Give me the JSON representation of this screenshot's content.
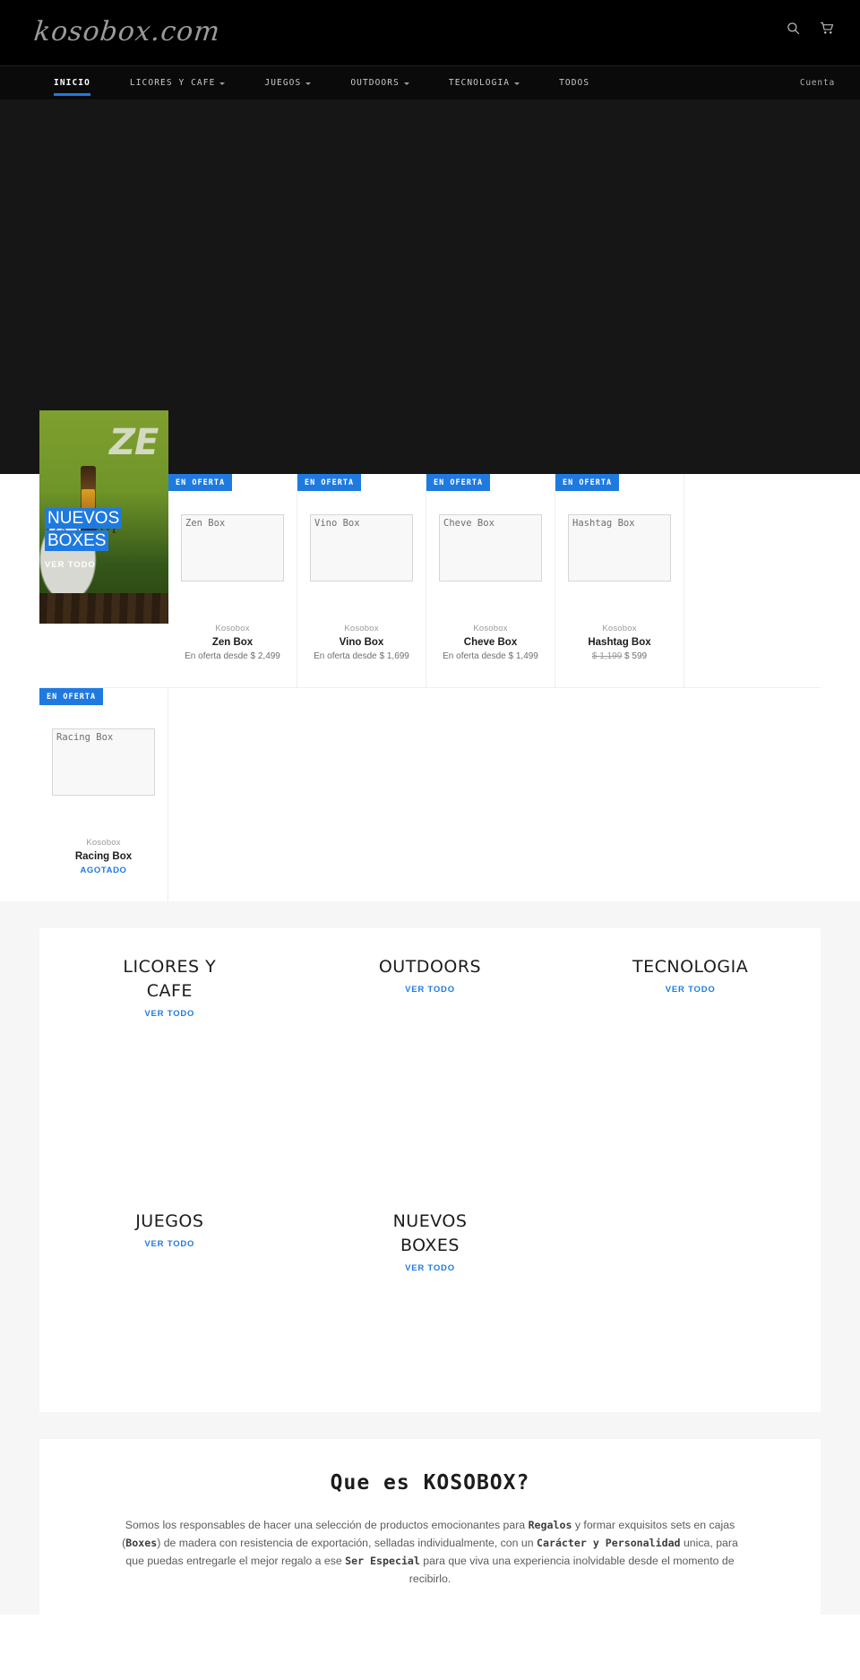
{
  "header": {
    "logo_text": "kosobox.com",
    "search_icon": "search-icon",
    "cart_icon": "cart-icon"
  },
  "nav": {
    "items": [
      {
        "label": "INICIO",
        "has_caret": false,
        "active": true
      },
      {
        "label": "LICORES Y CAFE",
        "has_caret": true,
        "active": false
      },
      {
        "label": "JUEGOS",
        "has_caret": true,
        "active": false
      },
      {
        "label": "OUTDOORS",
        "has_caret": true,
        "active": false
      },
      {
        "label": "TECNOLOGIA",
        "has_caret": true,
        "active": false
      },
      {
        "label": "TODOS",
        "has_caret": false,
        "active": false
      }
    ],
    "account_label": "Cuenta"
  },
  "promo": {
    "title_line1": "NUEVOS",
    "title_line2": "BOXES",
    "link_label": "VER TODO",
    "image_text_zen": "ZE",
    "image_text_b": "B",
    "image_script": "ox.com",
    "highlight_color": "#1f7ae0"
  },
  "products": {
    "sale_badge_label": "EN OFERTA",
    "sold_out_label": "AGOTADO",
    "items": [
      {
        "alt_text": "Zen Box",
        "vendor": "Kosobox",
        "title": "Zen Box",
        "price": "En oferta desde $ 2,499",
        "on_sale": true,
        "sold_out": false
      },
      {
        "alt_text": "Vino Box",
        "vendor": "Kosobox",
        "title": "Vino Box",
        "price": "En oferta desde $ 1,699",
        "on_sale": true,
        "sold_out": false
      },
      {
        "alt_text": "Cheve Box",
        "vendor": "Kosobox",
        "title": "Cheve Box",
        "price": "En oferta desde $ 1,499",
        "on_sale": true,
        "sold_out": false
      },
      {
        "alt_text": "Hashtag Box",
        "vendor": "Kosobox",
        "title": "Hashtag Box",
        "price_was": "$ 1,199",
        "price_now": "$ 599",
        "on_sale": true,
        "sold_out": false
      },
      {
        "alt_text": "Racing Box",
        "vendor": "Kosobox",
        "title": "Racing Box",
        "price": "AGOTADO",
        "on_sale": true,
        "sold_out": true
      }
    ]
  },
  "categories": {
    "link_label": "VER TODO",
    "row1": [
      {
        "name": "LICORES Y CAFE"
      },
      {
        "name": "OUTDOORS"
      },
      {
        "name": "TECNOLOGIA"
      }
    ],
    "row2": [
      {
        "name": "JUEGOS"
      },
      {
        "name": "NUEVOS BOXES"
      }
    ]
  },
  "about": {
    "title": "Que es KOSOBOX?",
    "p1_a": "Somos los responsables de hacer una selección de productos emocionantes para ",
    "p1_b": "Regalos",
    "p1_c": " y formar exquisitos sets en cajas (",
    "p1_d": "Boxes",
    "p1_e": ") de madera con resistencia de exportación, selladas individualmente, con un ",
    "p1_f": "Carácter y Personalidad",
    "p1_g": " unica, para que puedas entregarle el mejor regalo a ese ",
    "p1_h": "Ser Especial",
    "p1_i": " para que viva una experiencia inolvidable desde el momento de recibirlo."
  }
}
